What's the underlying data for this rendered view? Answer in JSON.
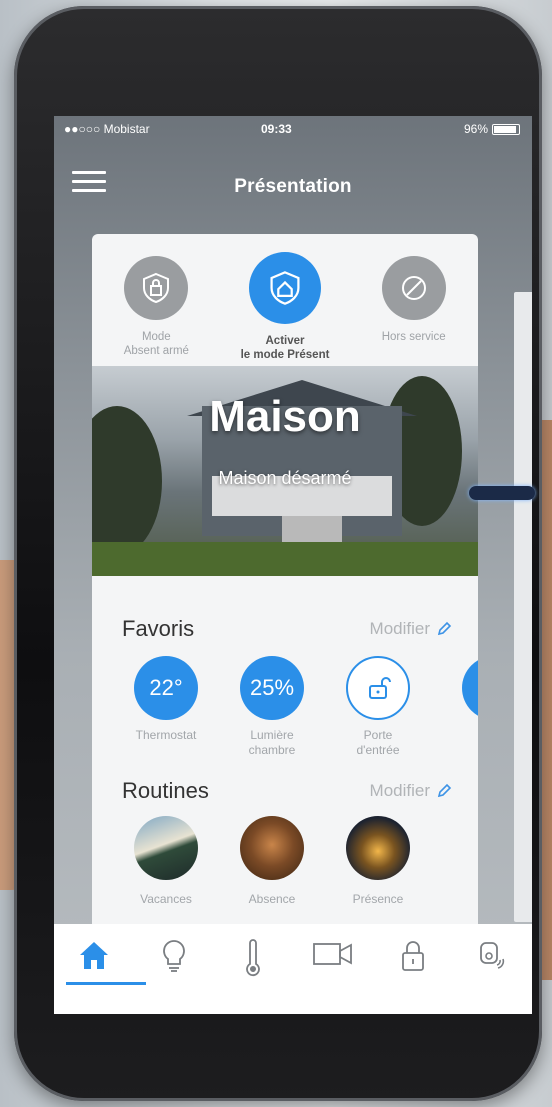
{
  "status_bar": {
    "carrier": "●●○○○ Mobistar",
    "time": "09:33",
    "battery": "96%"
  },
  "header": {
    "title": "Présentation"
  },
  "modes": [
    {
      "label_line1": "Mode",
      "label_line2": "Absent armé",
      "icon": "shield-lock-icon",
      "active": false
    },
    {
      "label_line1": "Activer",
      "label_line2": "le mode Présent",
      "icon": "shield-home-icon",
      "active": true
    },
    {
      "label_line1": "Hors service",
      "label_line2": "",
      "icon": "disabled-circle-icon",
      "active": false
    }
  ],
  "hero": {
    "title": "Maison",
    "subtitle": "Maison désarmé"
  },
  "favorites": {
    "title": "Favoris",
    "modify": "Modifier",
    "items": [
      {
        "value": "22°",
        "label_line1": "Thermostat",
        "label_line2": ""
      },
      {
        "value": "25%",
        "label_line1": "Lumière",
        "label_line2": "chambre"
      },
      {
        "value": "",
        "label_line1": "Porte",
        "label_line2": "d'entrée"
      }
    ]
  },
  "routines": {
    "title": "Routines",
    "modify": "Modifier",
    "items": [
      {
        "label": "Vacances"
      },
      {
        "label": "Absence"
      },
      {
        "label": "Présence"
      }
    ]
  },
  "tabbar": {
    "items": [
      "home-icon",
      "bulb-icon",
      "thermometer-icon",
      "camera-icon",
      "lock-icon",
      "sensor-icon"
    ],
    "active": "home-icon"
  },
  "colors": {
    "accent": "#2b8fe8",
    "muted_text": "#a2a6aa",
    "inactive_circle": "#9a9da0"
  }
}
